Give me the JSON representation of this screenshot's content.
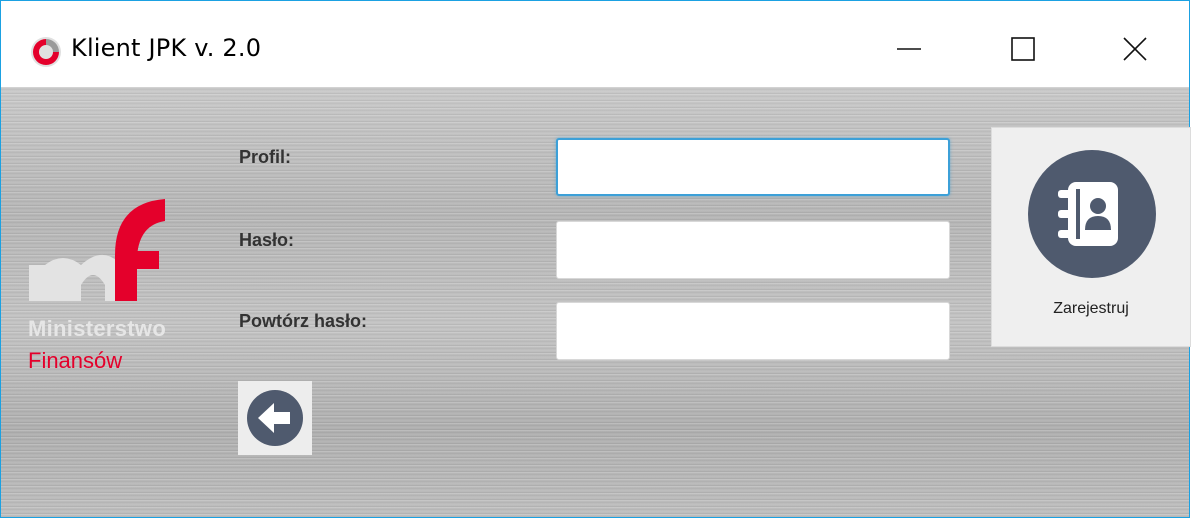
{
  "window": {
    "title": "Klient JPK v. 2.0",
    "icon": "mf-app-icon",
    "controls": [
      "minimize-icon",
      "maximize-icon",
      "close-icon"
    ]
  },
  "logo": {
    "line1": "Ministerstwo",
    "line2": "Finansów",
    "colors": {
      "accent": "#e4002b",
      "grey": "#e6e6e6"
    }
  },
  "form": {
    "profile_label": "Profil:",
    "profile_value": "",
    "password_label": "Hasło:",
    "password_value": "",
    "repeat_label": "Powtórz hasło:",
    "repeat_value": ""
  },
  "actions": {
    "register_label": "Zarejestruj",
    "register_icon": "address-book-icon",
    "back_icon": "arrow-left-icon"
  },
  "colors": {
    "icon_dark": "#4f5a6e",
    "focus_border": "#3ca0d8",
    "window_border": "#1ba1e2"
  }
}
